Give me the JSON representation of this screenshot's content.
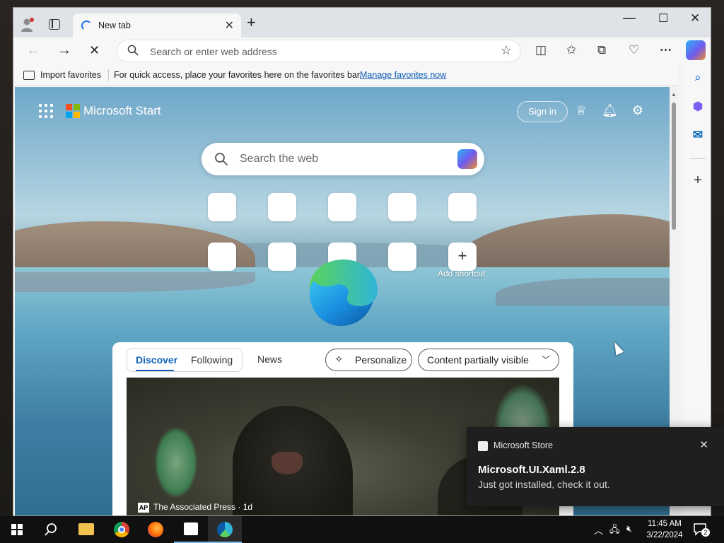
{
  "tab": {
    "title": "New tab"
  },
  "omnibox": {
    "placeholder": "Search or enter web address"
  },
  "favbar": {
    "import_label": "Import favorites",
    "tip": "For quick access, place your favorites here on the favorites bar.",
    "manage_link": "Manage favorites now"
  },
  "start_page": {
    "brand": "Microsoft Start",
    "sign_in": "Sign in",
    "search_placeholder": "Search the web",
    "add_shortcut_label": "Add shortcut",
    "feed": {
      "tabs": [
        "Discover",
        "Following"
      ],
      "news": "News",
      "personalize": "Personalize",
      "visibility": "Content partially visible",
      "source": "The Associated Press",
      "age": "1d",
      "source_badge": "AP"
    }
  },
  "toast": {
    "app": "Microsoft Store",
    "title": "Microsoft.UI.Xaml.2.8",
    "body": "Just got installed, check it out."
  },
  "taskbar": {
    "time": "11:45 AM",
    "date": "3/22/2024",
    "notifications": "2"
  },
  "colors": {
    "accent": "#0f5fb8",
    "taskbar": "#101010",
    "toast_bg": "#1f1f1f"
  }
}
